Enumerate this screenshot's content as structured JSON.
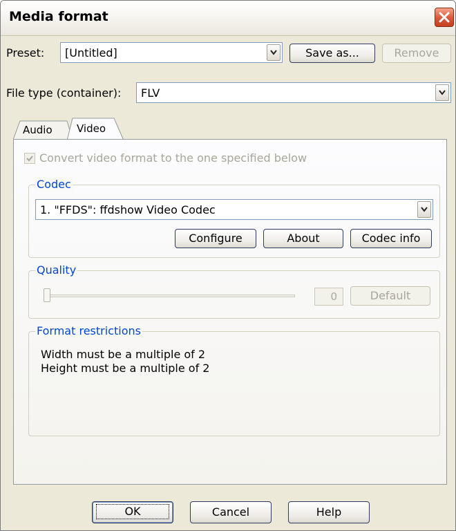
{
  "window": {
    "title": "Media format"
  },
  "preset": {
    "label": "Preset:",
    "value": "[Untitled]",
    "save_as": "Save as...",
    "remove": "Remove"
  },
  "file_type": {
    "label": "File type (container):",
    "value": "FLV"
  },
  "tabs": [
    {
      "label": "Audio"
    },
    {
      "label": "Video"
    }
  ],
  "video": {
    "convert_label": "Convert video format to the one specified below",
    "convert_checked": true,
    "codec": {
      "group_label": "Codec",
      "value": "1. \"FFDS\": ffdshow Video Codec",
      "configure": "Configure",
      "about": "About",
      "codec_info": "Codec info"
    },
    "quality": {
      "group_label": "Quality",
      "value": "0",
      "default": "Default",
      "slider_fraction": 0
    },
    "restrictions": {
      "group_label": "Format restrictions",
      "lines": [
        "Width must be a multiple of 2",
        "Height must be a multiple of 2"
      ]
    }
  },
  "buttons": {
    "ok": "OK",
    "cancel": "Cancel",
    "help": "Help"
  },
  "colors": {
    "group_label": "#0046d5",
    "close_button": "#d8563a",
    "disabled_text": "#a7a69a"
  }
}
